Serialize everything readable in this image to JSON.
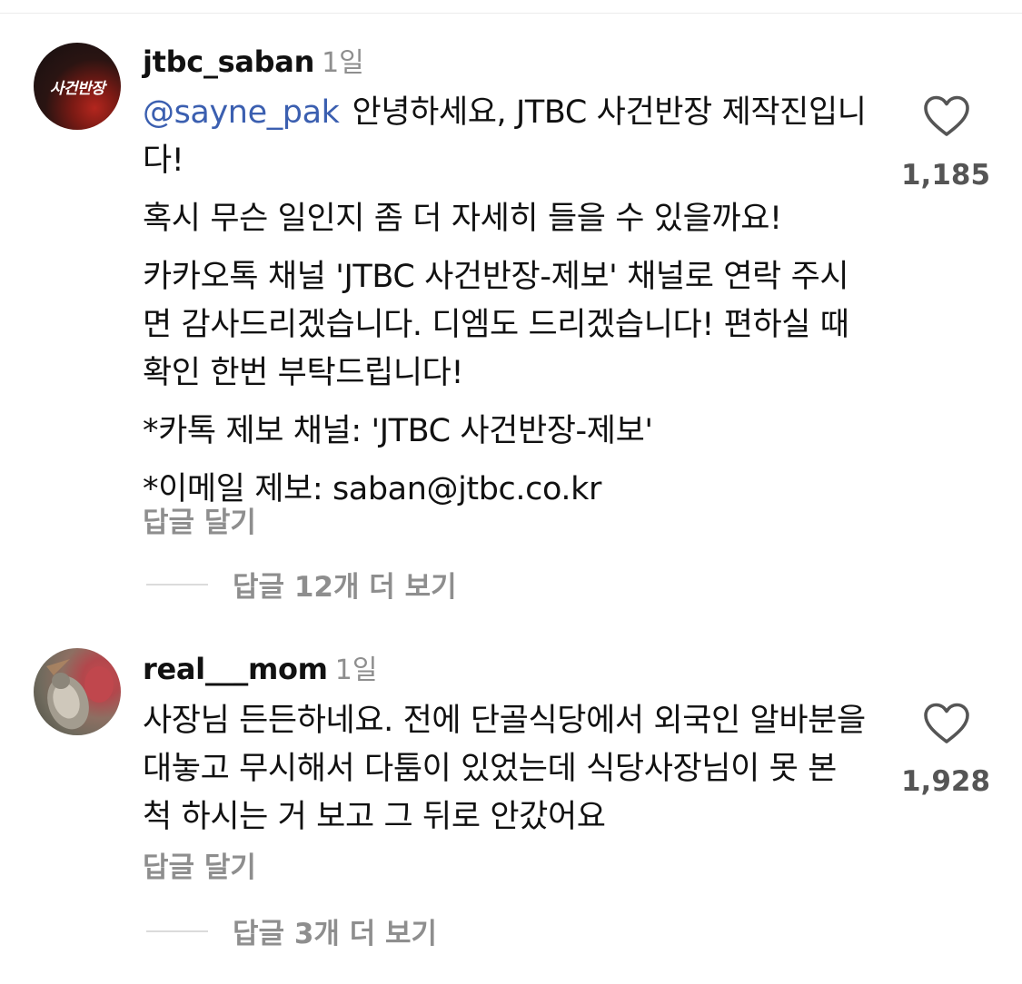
{
  "comments": [
    {
      "username": "jtbc_saban",
      "time": "1일",
      "avatar_text": "사건반장",
      "mention": "@sayne_pak",
      "paragraphs": [
        "안녕하세요, JTBC 사건반장 제작진입니다!",
        "혹시 무슨 일인지 좀 더 자세히 들을 수 있을까요!",
        "카카오톡 채널 'JTBC 사건반장-제보' 채널로 연락 주시면 감사드리겠습니다. 디엠도 드리겠습니다! 편하실 때 확인 한번 부탁드립니다!",
        "*카톡 제보 채널: 'JTBC 사건반장-제보'",
        "*이메일 제보: saban@jtbc.co.kr"
      ],
      "likes": "1,185",
      "reply_label": "답글 달기",
      "view_replies_label": "답글 12개 더 보기"
    },
    {
      "username": "real___mom",
      "time": "1일",
      "paragraphs": [
        "사장님 든든하네요. 전에 단골식당에서 외국인 알바분을 대놓고 무시해서 다툼이 있었는데 식당사장님이 못 본 척 하시는 거 보고 그 뒤로 안갔어요"
      ],
      "likes": "1,928",
      "reply_label": "답글 달기",
      "view_replies_label": "답글 3개 더 보기"
    }
  ],
  "icons": {
    "like": "heart-outline-icon"
  },
  "colors": {
    "mention": "#3b5fb0",
    "secondary_text": "#8e8e8e"
  }
}
